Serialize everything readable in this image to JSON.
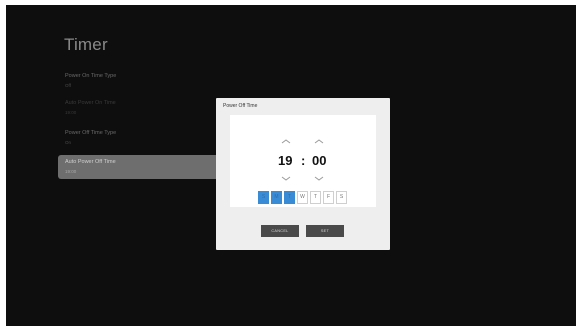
{
  "page": {
    "title": "Timer"
  },
  "menu": {
    "items": [
      {
        "label": "Power On Time Type",
        "value": "Off"
      },
      {
        "label": "Auto Power On Time",
        "value": "19:00"
      },
      {
        "label": "Power Off Time Type",
        "value": "On"
      },
      {
        "label": "Auto Power Off Time",
        "value": "19:00"
      }
    ]
  },
  "dialog": {
    "title": "Power Off Time",
    "hour": "19",
    "separator": ":",
    "minute": "00",
    "days": [
      {
        "label": "S",
        "selected": true
      },
      {
        "label": "M",
        "selected": true
      },
      {
        "label": "T",
        "selected": true
      },
      {
        "label": "W",
        "selected": false
      },
      {
        "label": "T",
        "selected": false
      },
      {
        "label": "F",
        "selected": false
      },
      {
        "label": "S",
        "selected": false
      }
    ],
    "cancel_label": "CANCEL",
    "set_label": "SET"
  },
  "colors": {
    "background": "#0e0e0e",
    "selected_item": "#6e6e6e",
    "day_selected": "#3a8bd6",
    "button": "#4a4a4a"
  }
}
